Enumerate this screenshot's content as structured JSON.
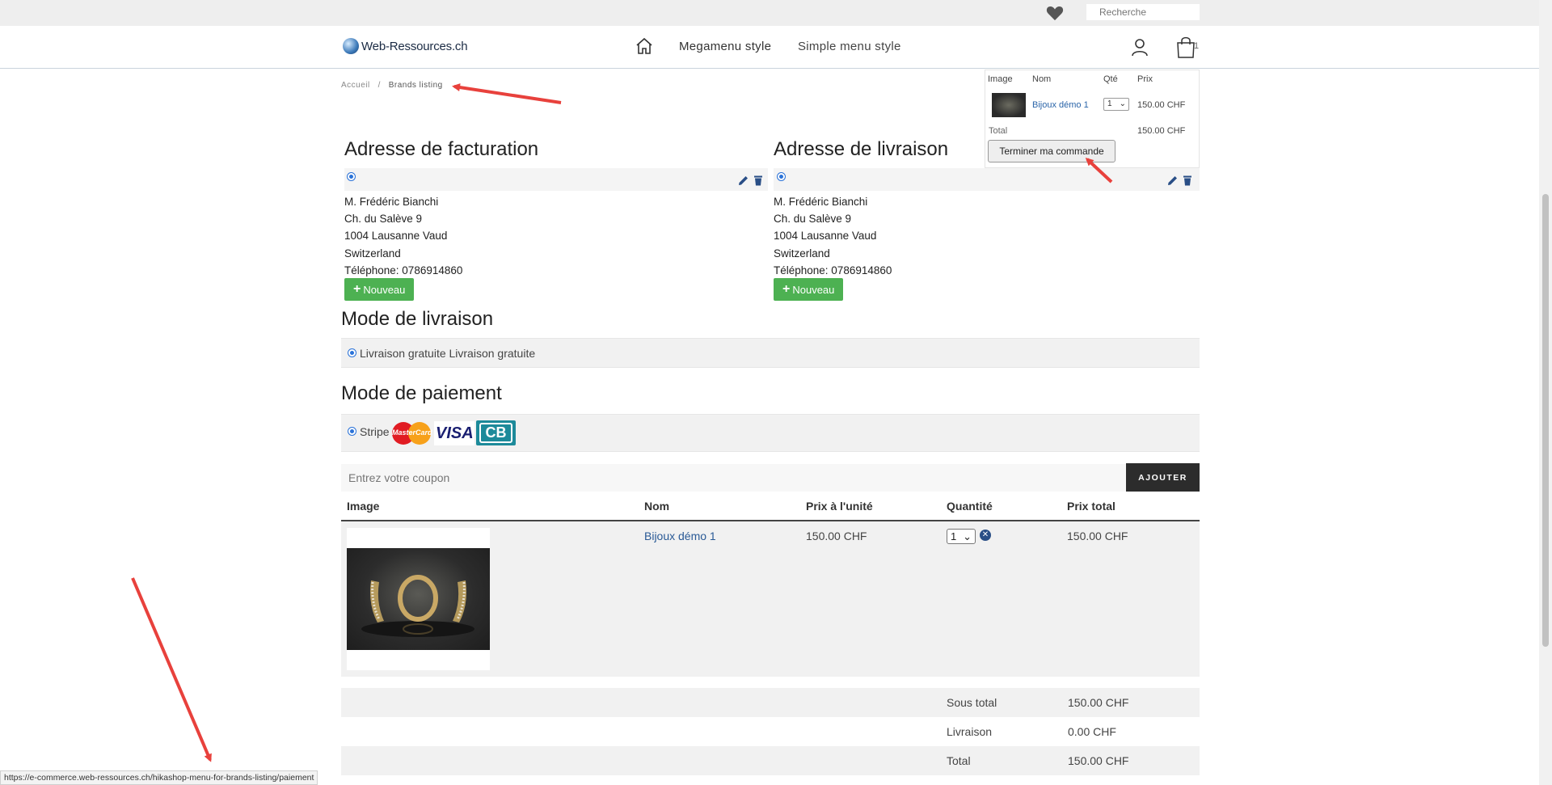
{
  "topbar": {
    "search_placeholder": "Recherche"
  },
  "header": {
    "logo_text": "Web-Ressources.ch",
    "nav": [
      "Megamenu style",
      "Simple menu style"
    ],
    "cart_count": "1"
  },
  "mini_cart": {
    "headers": [
      "Image",
      "Nom",
      "Qté",
      "Prix"
    ],
    "item_name": "Bijoux démo 1",
    "item_qty": "1",
    "item_price": "150.00 CHF",
    "total_label": "Total",
    "total_value": "150.00 CHF",
    "checkout_label": "Terminer ma commande"
  },
  "breadcrumb": {
    "home": "Accueil",
    "sep": "/",
    "current": "Brands listing"
  },
  "billing": {
    "title": "Adresse de facturation",
    "lines": [
      "M. Frédéric Bianchi",
      "Ch. du Salève 9",
      "1004 Lausanne Vaud",
      "Switzerland",
      "Téléphone: 0786914860"
    ],
    "new_label": "Nouveau"
  },
  "shipping": {
    "title": "Adresse de livraison",
    "lines": [
      "M. Frédéric Bianchi",
      "Ch. du Salève 9",
      "1004 Lausanne Vaud",
      "Switzerland",
      "Téléphone: 0786914860"
    ],
    "new_label": "Nouveau"
  },
  "delivery": {
    "title": "Mode de livraison",
    "option": "Livraison gratuite Livraison gratuite"
  },
  "payment": {
    "title": "Mode de paiement",
    "option": "Stripe",
    "cards": [
      "MasterCard",
      "VISA",
      "CB"
    ]
  },
  "coupon": {
    "placeholder": "Entrez votre coupon",
    "button": "AJOUTER"
  },
  "table": {
    "headers": [
      "Image",
      "Nom",
      "Prix à l'unité",
      "Quantité",
      "Prix total"
    ],
    "row": {
      "name": "Bijoux démo 1",
      "unit_price": "150.00 CHF",
      "qty": "1",
      "total": "150.00 CHF"
    }
  },
  "totals": [
    {
      "label": "Sous total",
      "value": "150.00 CHF"
    },
    {
      "label": "Livraison",
      "value": "0.00 CHF"
    },
    {
      "label": "Total",
      "value": "150.00 CHF"
    }
  ],
  "status_url": "https://e-commerce.web-ressources.ch/hikashop-menu-for-brands-listing/paiement",
  "colors": {
    "accent_blue": "#2a5a96",
    "green": "#4db152",
    "dark_button": "#2c2c2c",
    "arrow_red": "#e8413c"
  }
}
